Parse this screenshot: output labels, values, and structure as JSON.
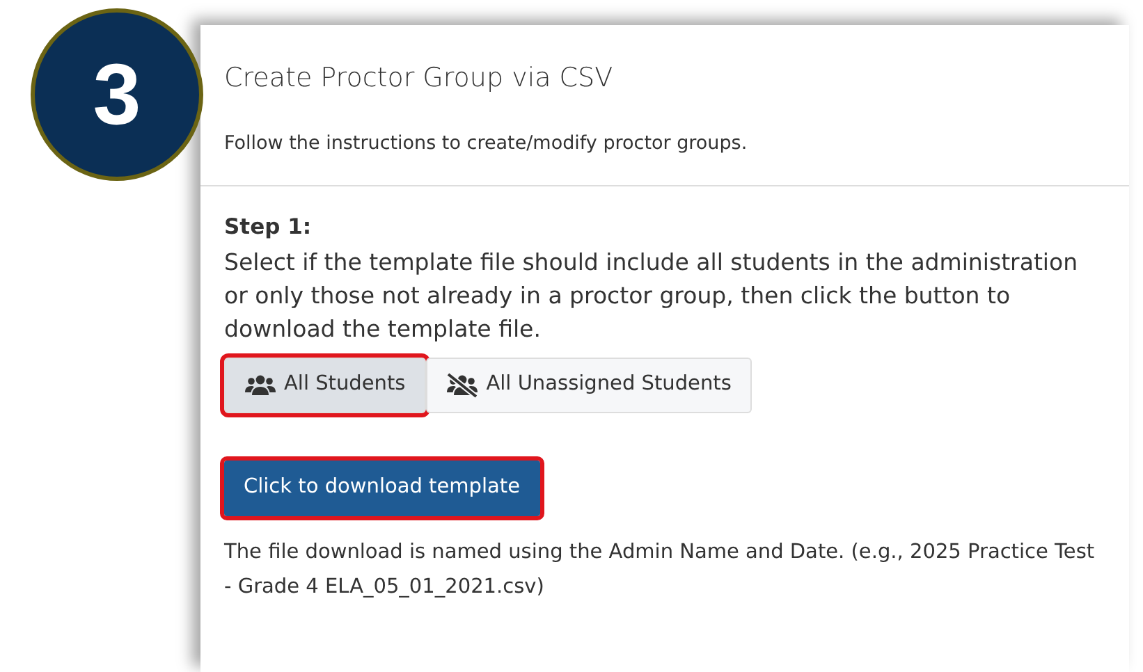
{
  "step_badge": "3",
  "panel": {
    "title": "Create Proctor Group via CSV",
    "subtitle": "Follow the instructions to create/modify proctor groups."
  },
  "step": {
    "label": "Step 1:",
    "instructions": "Select if the template file should include all students in the administration or only those not already in a proctor group, then click the button to download the template file."
  },
  "options": [
    {
      "label": "All Students",
      "kind": "all",
      "selected": true,
      "highlighted": true
    },
    {
      "label": "All Unassigned Students",
      "kind": "unassigned",
      "selected": false,
      "highlighted": false
    }
  ],
  "download_button": {
    "label": "Click to download template",
    "highlighted": true
  },
  "note": "The file download is named using the Admin Name and Date. (e.g., 2025 Practice Test - Grade 4 ELA_05_01_2021.csv)"
}
